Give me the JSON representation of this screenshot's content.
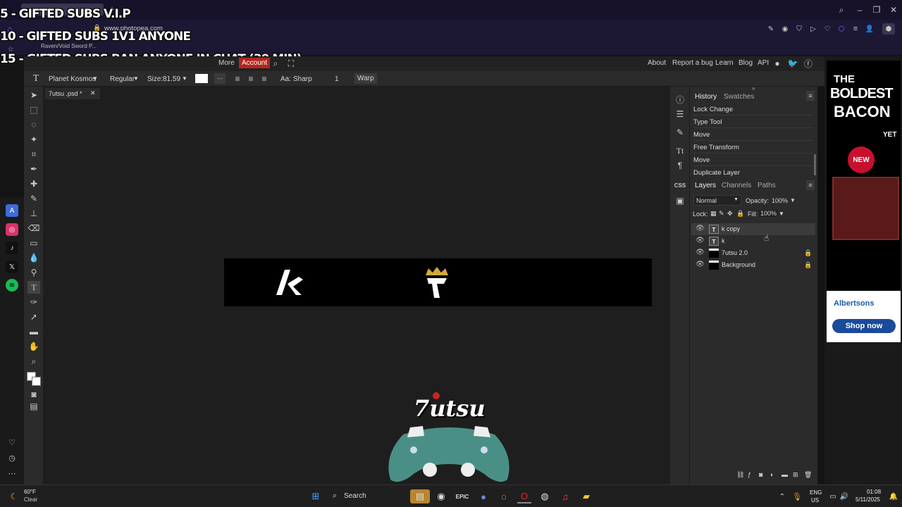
{
  "browser": {
    "tab_title": "Raven/Void Sword P...",
    "url": "www.photopea.com",
    "accent": "#8a6cff"
  },
  "stream_overlay": {
    "line1": "5 - GIFTED SUBS V.I.P",
    "line2": "10 - GIFTED SUBS 1V1 ANYONE",
    "line3": "15 - GIFTED SUBS BAN ANYONE IN CHAT (30 MIN)"
  },
  "menubar": {
    "more": "More",
    "account": "Account",
    "about": "About",
    "report_bug": "Report a bug",
    "learn": "Learn",
    "blog": "Blog",
    "api": "API"
  },
  "options": {
    "font_family": "Planet Kosmos",
    "font_style": "Regular",
    "size_label": "Size:",
    "size_value": "81.59",
    "aa_label": "Aa:",
    "aa_value": "Sharp",
    "tracking": "1",
    "warp": "Warp"
  },
  "document": {
    "tab_title": "7utsu .psd *"
  },
  "history": {
    "tab_history": "History",
    "tab_swatches": "Swatches",
    "items": [
      "Lock Change",
      "Type Tool",
      "Move",
      "Free Transform",
      "Move",
      "Duplicate Layer"
    ]
  },
  "layers": {
    "tab_layers": "Layers",
    "tab_channels": "Channels",
    "tab_paths": "Paths",
    "blend_mode": "Normal",
    "opacity_label": "Opacity:",
    "opacity_value": "100%",
    "lock_label": "Lock:",
    "fill_label": "Fill:",
    "fill_value": "100%",
    "items": [
      {
        "name": "k copy",
        "type": "text"
      },
      {
        "name": "k",
        "type": "text"
      },
      {
        "name": "7utsu 2.0",
        "type": "image"
      },
      {
        "name": "Background",
        "type": "image"
      }
    ]
  },
  "ad": {
    "headline1": "THE",
    "headline2": "BOLDEST",
    "headline3": "BACON",
    "headline4": "YET",
    "badge": "NEW",
    "brand": "Albertsons",
    "cta": "Shop now"
  },
  "watermark": {
    "text": "7utsu"
  },
  "taskbar": {
    "temperature": "60°F",
    "condition": "Clear",
    "search": "Search",
    "lang1": "ENG",
    "lang2": "US",
    "time": "01:08",
    "date": "5/11/2025"
  }
}
